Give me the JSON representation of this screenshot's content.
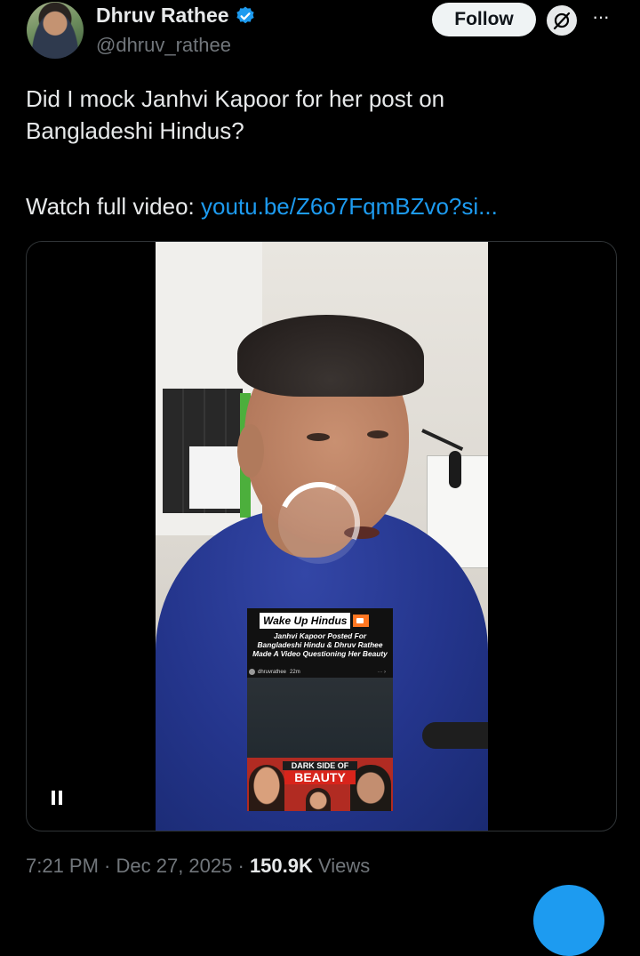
{
  "author": {
    "name": "Dhruv Rathee",
    "handle": "@dhruv_rathee",
    "verified": true
  },
  "actions": {
    "follow_label": "Follow",
    "grok_icon": "grok-icon",
    "more_label": "···"
  },
  "tweet": {
    "line1": "Did I mock Janhvi Kapoor for her post on",
    "line2": "Bangladeshi Hindus?",
    "watch_prefix": "Watch full video: ",
    "link_text": "youtu.be/Z6o7FqmBZvo?si..."
  },
  "video": {
    "state": "playing",
    "overlay_card": {
      "title": "Wake Up Hindus",
      "subtitle": "Janhvi Kapoor Posted For Bangladeshi Hindu & Dhruv Rathee Made A Video Questioning Her Beauty",
      "story_user": "dhruvrathee",
      "story_time": "22m",
      "thumb_line1": "DARK SIDE OF",
      "thumb_line2": "BEAUTY"
    }
  },
  "meta": {
    "time": "7:21 PM",
    "separator": " · ",
    "date": "Dec 27, 2025",
    "views_count": "150.9K",
    "views_label": "Views"
  },
  "colors": {
    "background": "#000000",
    "text": "#e7e9ea",
    "secondary": "#71767b",
    "link": "#1d9bf0",
    "verified": "#1d9bf0"
  }
}
